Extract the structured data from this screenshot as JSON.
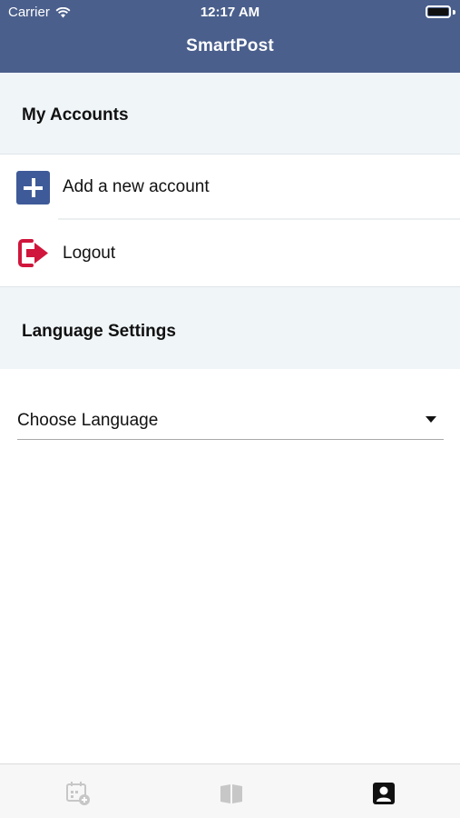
{
  "status_bar": {
    "carrier": "Carrier",
    "time": "12:17 AM"
  },
  "header": {
    "title": "SmartPost"
  },
  "accounts_section": {
    "title": "My Accounts",
    "items": [
      {
        "label": "Add a new account",
        "icon": "add-icon"
      },
      {
        "label": "Logout",
        "icon": "logout-icon"
      }
    ]
  },
  "language_section": {
    "title": "Language Settings",
    "select_value": "Choose Language"
  },
  "tab_bar": {
    "items": [
      {
        "icon": "calendar-add-icon",
        "active": false
      },
      {
        "icon": "book-icon",
        "active": false
      },
      {
        "icon": "profile-icon",
        "active": true
      }
    ]
  },
  "colors": {
    "header_bg": "#4a5f8c",
    "section_bg": "#f0f5f8",
    "add_icon": "#3f5a98",
    "logout_icon": "#d0163c",
    "tab_inactive": "#c7c7c7",
    "tab_active": "#111111"
  }
}
